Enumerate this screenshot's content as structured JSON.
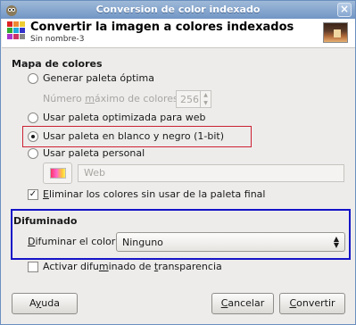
{
  "window": {
    "title": "Conversion de color indexado",
    "close_glyph": "×"
  },
  "header": {
    "title": "Convertir la imagen a colores indexados",
    "subtitle": "Sin nombre-3"
  },
  "palette_section": {
    "title": "Mapa de colores",
    "options": [
      {
        "label": "Generar paleta óptima",
        "checked": false,
        "disabled": false
      },
      {
        "label": "Usar paleta optimizada para web",
        "checked": false,
        "disabled": false
      },
      {
        "label": "Usar paleta en blanco y negro (1-bit)",
        "checked": true,
        "disabled": false
      },
      {
        "label": "Usar paleta personal",
        "checked": false,
        "disabled": false
      }
    ],
    "max_colors_label_pre": "Número ",
    "max_colors_label_u": "m",
    "max_colors_label_post": "áximo de colores:",
    "max_colors_value": "256",
    "custom_palette_name": "Web",
    "remove_unused_label_u": "E",
    "remove_unused_label": "liminar los colores sin usar de la paleta final",
    "remove_unused_checked": true
  },
  "dither_section": {
    "title": "Difuminado",
    "dither_label_u": "D",
    "dither_label": "ifuminar el color:",
    "dither_value": "Ninguno",
    "transparency_label_pre": "Activar difu",
    "transparency_label_u": "m",
    "transparency_label_post": "inado de ",
    "transparency_label_u2": "t",
    "transparency_label_end": "ransparencia",
    "transparency_checked": false
  },
  "buttons": {
    "help_u": "y",
    "help_pre": "A",
    "help_post": "uda",
    "cancel_u": "C",
    "cancel_post": "ancelar",
    "convert_u": "C",
    "convert_post": "onvertir"
  },
  "colors": {
    "title_bar": "#7196c5",
    "red_highlight": "#cc2233",
    "blue_highlight": "#1414c8"
  }
}
